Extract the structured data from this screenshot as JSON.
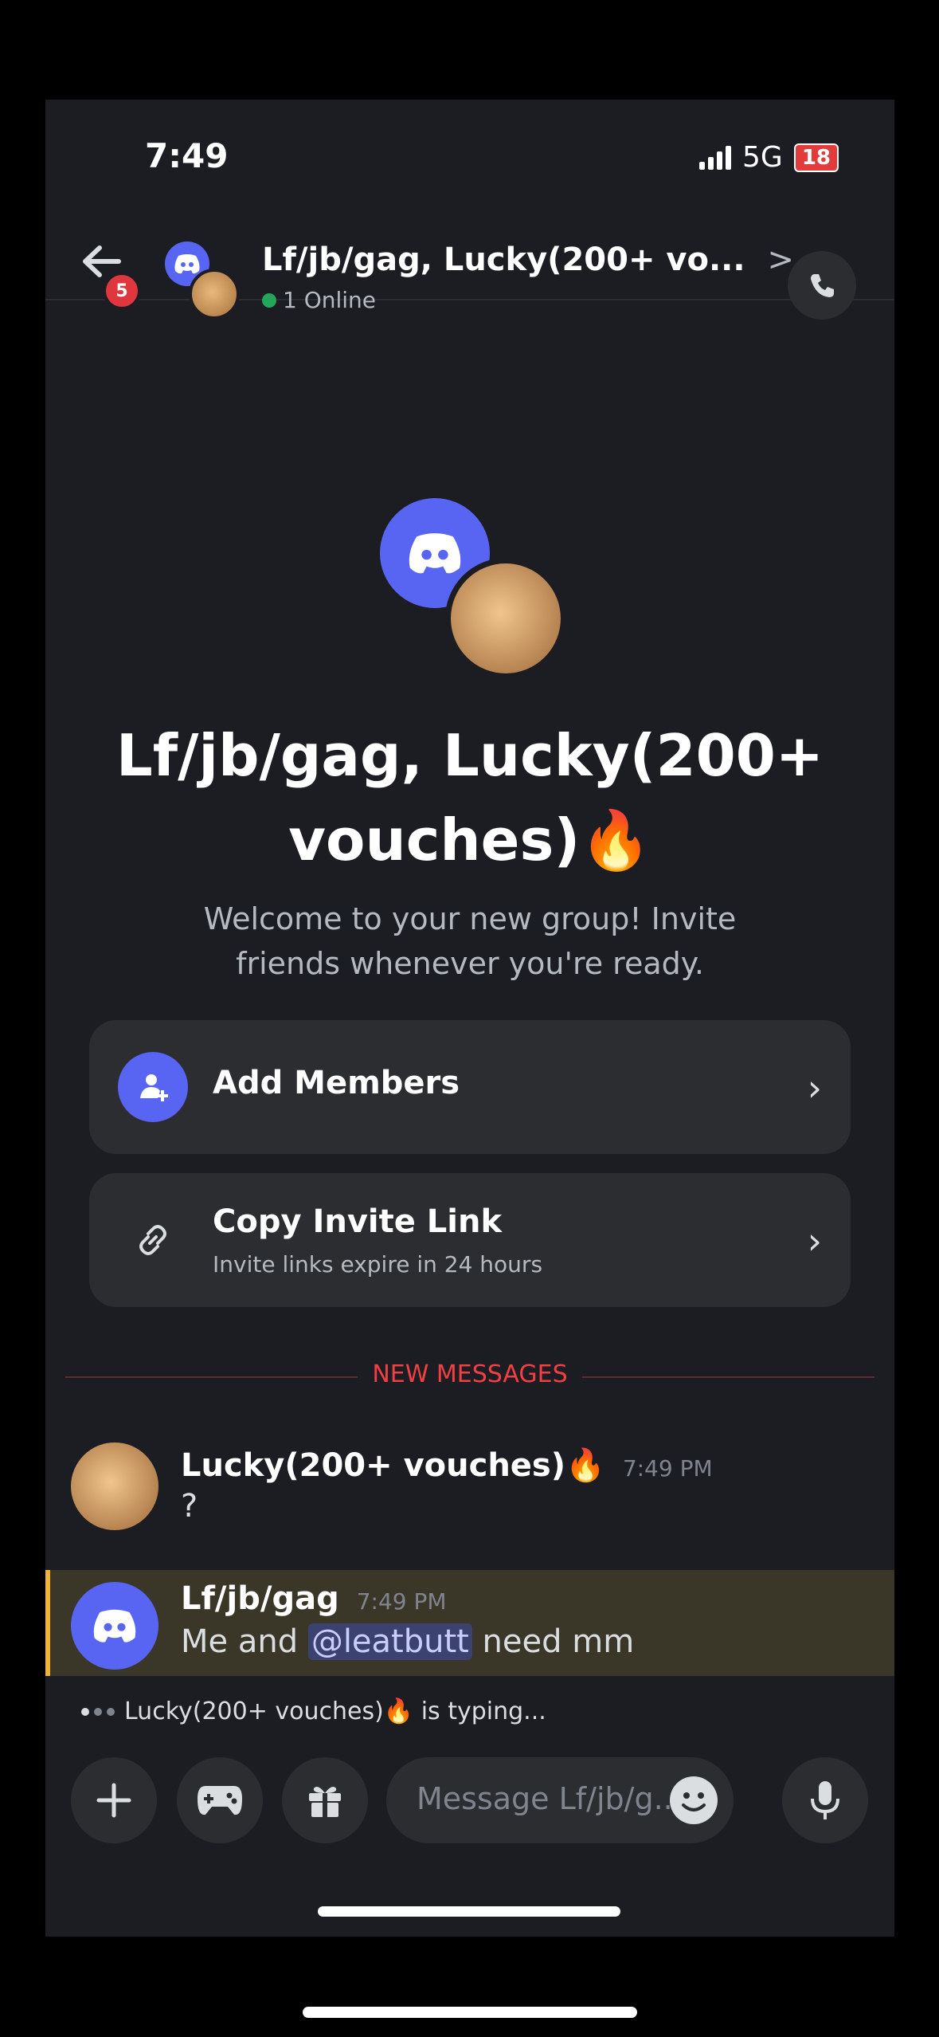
{
  "status_bar": {
    "time": "7:49",
    "network": "5G",
    "battery": "18"
  },
  "header": {
    "back_badge": "5",
    "title": "Lf/jb/gag, Lucky(200+ vo...",
    "chevron": ">",
    "online": "1 Online"
  },
  "hero": {
    "title": "Lf/jb/gag, Lucky(200+ vouches)🔥",
    "welcome": "Welcome to your new group! Invite friends whenever you're ready."
  },
  "actions": {
    "add_members": "Add Members",
    "copy_invite": "Copy Invite Link",
    "copy_invite_sub": "Invite links expire in 24 hours",
    "chevron": "›"
  },
  "divider": {
    "label": "NEW MESSAGES"
  },
  "messages": [
    {
      "author": "Lucky(200+ vouches)🔥",
      "time": "7:49 PM",
      "text": "?"
    },
    {
      "author": "Lf/jb/gag",
      "time": "7:49 PM",
      "text_before": "Me and ",
      "mention": "@leatbutt",
      "text_after": " need mm"
    }
  ],
  "typing": "Lucky(200+ vouches)🔥 is typing...",
  "composer": {
    "placeholder": "Message Lf/jb/g..."
  },
  "icons": {
    "back": "back-arrow-icon",
    "call": "phone-call-icon",
    "discord": "discord-logo-icon",
    "add_members": "add-user-icon",
    "link": "link-icon",
    "plus": "plus-icon",
    "game": "gamepad-icon",
    "gift": "gift-icon",
    "emoji": "emoji-icon",
    "mic": "microphone-icon"
  },
  "colors": {
    "blurple": "#5865f2",
    "new_messages": "#f23f43",
    "online": "#23a55a",
    "highlight": "#3a3729",
    "highlight_bar": "#f0b232"
  }
}
